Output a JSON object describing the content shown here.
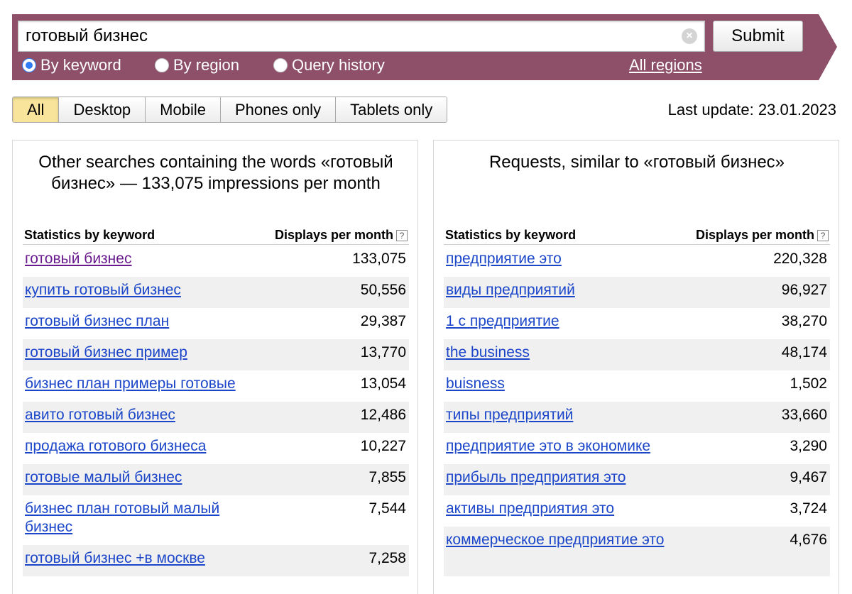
{
  "search": {
    "query": "готовый бизнес",
    "submit_label": "Submit",
    "clear_symbol": "×",
    "modes": [
      {
        "label": "By keyword",
        "checked": true
      },
      {
        "label": "By region",
        "checked": false
      },
      {
        "label": "Query history",
        "checked": false
      }
    ],
    "regions_label": "All regions"
  },
  "device_tabs": [
    {
      "label": "All",
      "active": true
    },
    {
      "label": "Desktop",
      "active": false
    },
    {
      "label": "Mobile",
      "active": false
    },
    {
      "label": "Phones only",
      "active": false
    },
    {
      "label": "Tablets only",
      "active": false
    }
  ],
  "last_update": "Last update: 23.01.2023",
  "left_panel": {
    "title": "Other searches containing the words «готовый бизнес» — 133,075 impressions per month",
    "col_keyword": "Statistics by keyword",
    "col_count": "Displays per month",
    "rows": [
      {
        "keyword": "готовый бизнес",
        "count": "133,075"
      },
      {
        "keyword": "купить готовый бизнес",
        "count": "50,556"
      },
      {
        "keyword": "готовый бизнес план",
        "count": "29,387"
      },
      {
        "keyword": "готовый бизнес пример",
        "count": "13,770"
      },
      {
        "keyword": "бизнес план примеры готовые",
        "count": "13,054"
      },
      {
        "keyword": "авито готовый бизнес",
        "count": "12,486"
      },
      {
        "keyword": "продажа готового бизнеса",
        "count": "10,227"
      },
      {
        "keyword": "готовые малый бизнес",
        "count": "7,855"
      },
      {
        "keyword": "бизнес план готовый малый бизнес",
        "count": "7,544"
      },
      {
        "keyword": "готовый бизнес +в москве",
        "count": "7,258"
      }
    ]
  },
  "right_panel": {
    "title": "Requests, similar to «готовый бизнес»",
    "col_keyword": "Statistics by keyword",
    "col_count": "Displays per month",
    "rows": [
      {
        "keyword": "предприятие это",
        "count": "220,328"
      },
      {
        "keyword": "виды предприятий",
        "count": "96,927"
      },
      {
        "keyword": "1 с предприятие",
        "count": "38,270"
      },
      {
        "keyword": "the business",
        "count": "48,174"
      },
      {
        "keyword": "buisness",
        "count": "1,502"
      },
      {
        "keyword": "типы предприятий",
        "count": "33,660"
      },
      {
        "keyword": "предприятие это в экономике",
        "count": "3,290"
      },
      {
        "keyword": "прибыль предприятия это",
        "count": "9,467"
      },
      {
        "keyword": "активы предприятия это",
        "count": "3,724"
      },
      {
        "keyword": "коммерческое предприятие это",
        "count": "4,676"
      }
    ]
  },
  "colors": {
    "search_bar": "#8e5069",
    "tab_active": "#f8e49a",
    "link": "#1b46c9",
    "visited_link": "#6a1a8e",
    "radio_checked": "#2f7df6"
  }
}
